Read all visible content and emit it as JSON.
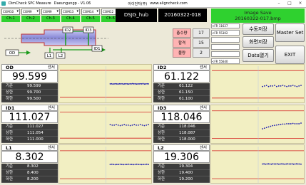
{
  "title_bar": {
    "app_title": "DimCheck SPC Measure",
    "user": "Daeungungp - V1.06",
    "company": "아이전자(주)",
    "url": "www.aligncheck.com"
  },
  "com_ports": [
    "COM10",
    "COM9",
    "COM9",
    "COM13",
    "COM14",
    "COM12"
  ],
  "channels": [
    "Ch-1",
    "Ch-2",
    "Ch-3",
    "Ch-4",
    "Ch-5",
    "Ch-6"
  ],
  "model_name": "DSJG_hub",
  "date_code": "20160322-018",
  "image_save": {
    "title": "Image Save",
    "filename": "20160322-017.bmp"
  },
  "diagram_labels": {
    "id2": "ID2",
    "id3": "ID3",
    "od": "OD",
    "id1": "ID1",
    "l1": "L1",
    "l2": "L2"
  },
  "counts": [
    {
      "label": "총수량",
      "value": "17"
    },
    {
      "label": "합격",
      "value": "15"
    },
    {
      "label": "불량",
      "value": "2"
    }
  ],
  "messages": [
    "<FR 11627",
    "<FR 55302",
    "<FR 55640"
  ],
  "buttons": {
    "manual_save": "수동저장",
    "master_set": "Master Set",
    "screen_save": "화면저장",
    "data_view": "Data열기",
    "exit": "EXIT"
  },
  "sensor_label": "센서",
  "row_labels": {
    "base": "기준",
    "upper": "상한",
    "lower": "하한"
  },
  "panels": [
    {
      "name": "OD",
      "value": "99.599",
      "base": "99.599",
      "upper": "99.700",
      "lower": "99.500"
    },
    {
      "name": "ID2",
      "value": "61.122",
      "base": "61.122",
      "upper": "61.150",
      "lower": "61.100"
    },
    {
      "name": "ID1",
      "value": "111.027",
      "base": "111.027",
      "upper": "111.054",
      "lower": "111.000"
    },
    {
      "name": "ID3",
      "value": "118.046",
      "base": "118.046",
      "upper": "118.087",
      "lower": "118.000"
    },
    {
      "name": "L1",
      "value": "8.302",
      "base": "8.302",
      "upper": "8.400",
      "lower": "8.200"
    },
    {
      "name": "L2",
      "value": "19.306",
      "base": "19.304",
      "upper": "19.400",
      "lower": "19.200"
    }
  ],
  "chart_data": [
    {
      "type": "scatter",
      "series_of": "OD",
      "y": [
        99.598,
        99.599,
        99.597,
        99.598,
        99.599,
        99.598,
        99.597,
        99.599,
        99.598,
        99.599,
        99.597,
        99.598,
        99.599,
        99.598,
        99.597,
        99.599,
        99.598,
        99.6,
        99.598,
        99.599,
        99.597,
        99.598,
        99.598,
        99.599,
        99.598,
        99.6,
        99.597,
        99.598,
        99.599,
        99.598
      ],
      "upper": 99.7,
      "lower": 99.5,
      "ylim": [
        99.46,
        99.73
      ]
    },
    {
      "type": "scatter",
      "series_of": "ID2",
      "y": [
        61.121,
        61.122,
        61.123,
        61.121,
        61.122,
        61.122,
        61.123,
        61.121,
        61.122,
        61.122,
        61.123,
        61.122,
        61.121,
        61.122,
        61.122,
        61.123,
        61.122,
        61.121,
        61.122,
        61.123
      ],
      "upper": 61.15,
      "lower": 61.1,
      "ylim": [
        61.092,
        61.158
      ]
    },
    {
      "type": "scatter",
      "series_of": "ID1",
      "y": [
        111.028,
        111.027,
        111.027,
        111.028,
        111.027,
        111.026,
        111.027,
        111.028,
        111.027,
        111.027,
        111.026,
        111.027,
        111.028,
        111.027,
        111.027,
        111.028,
        111.027,
        111.026,
        111.027,
        111.028
      ],
      "upper": 111.054,
      "lower": 111.0,
      "ylim": [
        110.99,
        111.065
      ]
    },
    {
      "type": "scatter",
      "series_of": "ID3",
      "y": [
        118.03,
        118.032,
        118.034,
        118.036,
        118.038,
        118.04,
        118.041,
        118.042,
        118.043,
        118.044,
        118.045,
        118.045,
        118.046,
        118.046,
        118.046,
        118.047,
        118.046,
        118.046,
        118.046,
        118.048
      ],
      "upper": 118.087,
      "lower": 118.0,
      "ylim": [
        117.985,
        118.1
      ]
    },
    {
      "type": "scatter",
      "series_of": "L1",
      "y": [
        8.302,
        8.303,
        8.302,
        8.301,
        8.302,
        8.302,
        8.303,
        8.302,
        8.301,
        8.302,
        8.302,
        8.303,
        8.302,
        8.302,
        8.301,
        8.302,
        8.303,
        8.302,
        8.302,
        8.301,
        8.302,
        8.302,
        8.303,
        8.302
      ],
      "upper": 8.4,
      "lower": 8.2,
      "ylim": [
        8.17,
        8.43
      ]
    },
    {
      "type": "scatter",
      "series_of": "L2",
      "y": [
        19.305,
        19.306,
        19.304,
        19.305,
        19.306,
        19.305,
        19.304,
        19.306,
        19.305,
        19.305,
        19.306,
        19.304,
        19.305,
        19.306,
        19.305,
        19.304,
        19.305,
        19.306,
        19.305,
        19.305,
        19.306,
        19.304,
        19.305,
        19.306,
        19.305,
        19.305,
        19.304
      ],
      "upper": 19.4,
      "lower": 19.2,
      "ylim": [
        19.17,
        19.43
      ]
    }
  ]
}
